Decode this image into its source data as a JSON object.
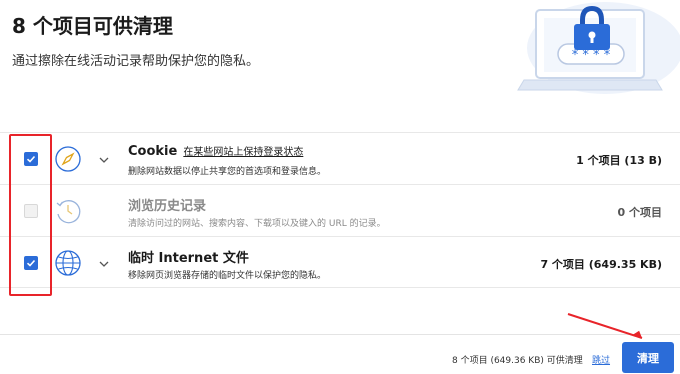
{
  "header": {
    "title": "8 个项目可供清理",
    "subtitle": "通过擦除在线活动记录帮助保护您的隐私。",
    "hero_icon": "laptop-lock-illustration",
    "password_mask": "* * * *"
  },
  "items": [
    {
      "checked": true,
      "enabled": true,
      "icon": "compass-icon",
      "name": "Cookie",
      "link": "在某些网站上保持登录状态",
      "description": "删除网站数据以停止共享您的首选项和登录信息。",
      "count": "1 个项目 (13 B)"
    },
    {
      "checked": false,
      "enabled": false,
      "icon": "history-icon",
      "name": "浏览历史记录",
      "link": "",
      "description": "清除访问过的网站、搜索内容、下载项以及键入的 URL 的记录。",
      "count": "0 个项目"
    },
    {
      "checked": true,
      "enabled": true,
      "icon": "globe-icon",
      "name": "临时 Internet 文件",
      "link": "",
      "description": "移除网页浏览器存储的临时文件以保护您的隐私。",
      "count": "7 个项目 (649.35 KB)"
    }
  ],
  "footer": {
    "summary": "8 个项目 (649.36 KB) 可供清理",
    "skip_label": "跳过",
    "clean_label": "清理"
  },
  "colors": {
    "accent": "#2b6cd8",
    "annotation_red": "#e8242a"
  }
}
